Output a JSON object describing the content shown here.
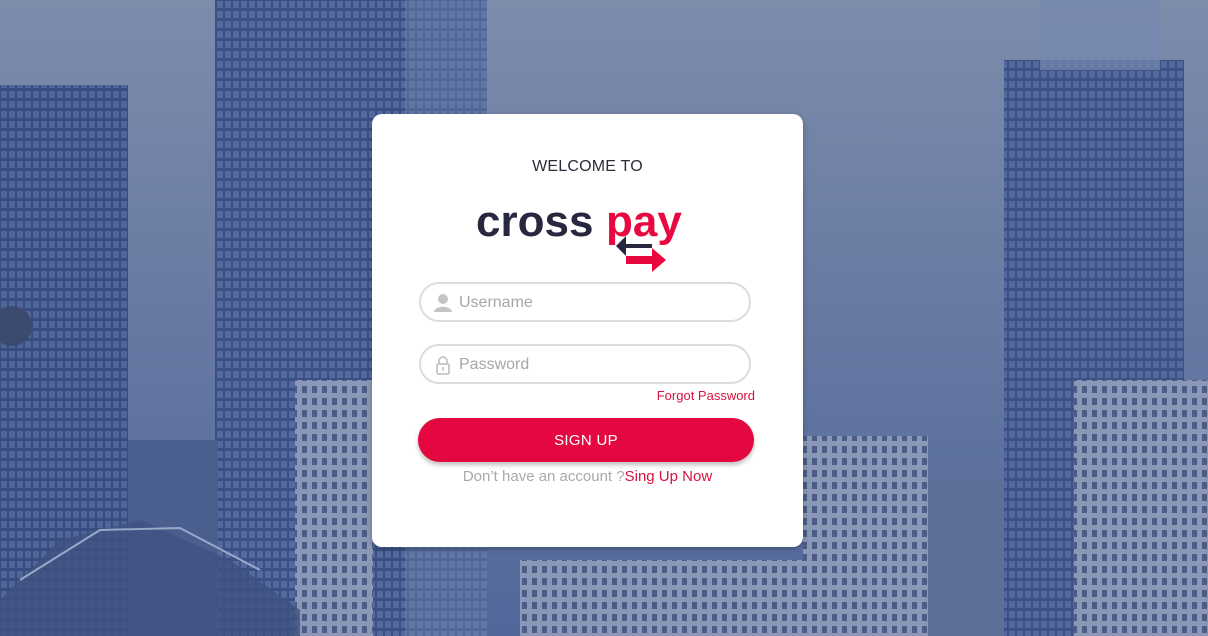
{
  "welcome": "WELCOME TO",
  "brand": {
    "part1": "cross",
    "part2": "pay",
    "dark": "#27273f",
    "accent": "#e8083f"
  },
  "username": {
    "placeholder": "Username",
    "icon": "user-icon"
  },
  "password": {
    "placeholder": "Password",
    "icon": "lock-icon"
  },
  "forgot": "Forgot Password",
  "button": "SIGN UP",
  "signup_prompt": "Don’t have an account ?",
  "signup_link": "Sing Up Now"
}
